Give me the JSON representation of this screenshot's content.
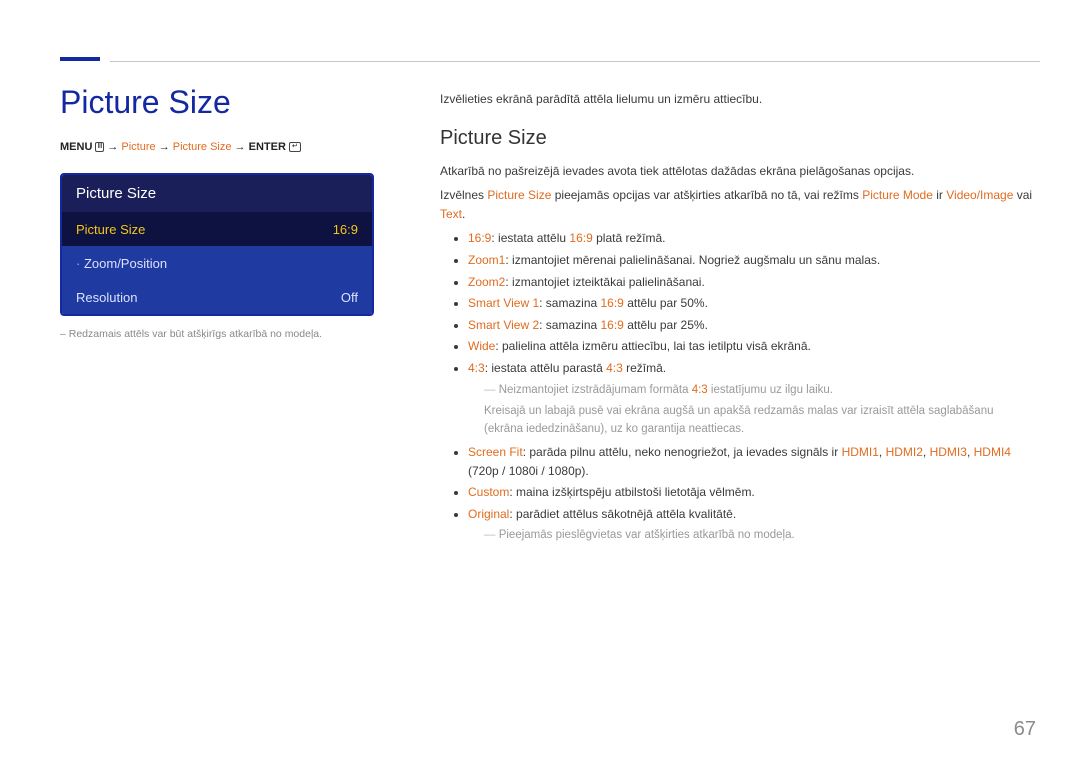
{
  "title": "Picture Size",
  "breadcrumb": {
    "menu": "MENU",
    "picture": "Picture",
    "picture_size": "Picture Size",
    "enter": "ENTER"
  },
  "panel": {
    "header": "Picture Size",
    "rows": [
      {
        "label": "Picture Size",
        "value": "16:9",
        "selected": true
      },
      {
        "label": "Zoom/Position",
        "value": "",
        "prefix": "·",
        "mutedPrefix": true
      },
      {
        "label": "Resolution",
        "value": "Off"
      }
    ]
  },
  "caption": "–  Redzamais attēls var būt atšķirīgs atkarībā no modeļa.",
  "intro": "Izvēlieties ekrānā parādītā attēla lielumu un izmēru attiecību.",
  "section_title": "Picture Size",
  "para1": "Atkarībā no pašreizējā ievades avota tiek attēlotas dažādas ekrāna pielāgošanas opcijas.",
  "para2_parts": {
    "a": "Izvēlnes ",
    "b": "Picture Size",
    "c": " pieejamās opcijas var atšķirties atkarībā no tā, vai režīms ",
    "d": "Picture Mode",
    "e": " ir ",
    "f": "Video/Image",
    "g": " vai ",
    "h": "Text",
    "i": "."
  },
  "bullets": [
    {
      "k": "16:9",
      "t": ": iestata attēlu ",
      "k2": "16:9",
      "t2": " platā režīmā."
    },
    {
      "k": "Zoom1",
      "t": ": izmantojiet mērenai palielināšanai. Nogriež augšmalu un sānu malas."
    },
    {
      "k": "Zoom2",
      "t": ": izmantojiet izteiktākai palielināšanai."
    },
    {
      "k": "Smart View 1",
      "t": ": samazina ",
      "k2": "16:9",
      "t2": " attēlu par 50%."
    },
    {
      "k": "Smart View 2",
      "t": ": samazina ",
      "k2": "16:9",
      "t2": " attēlu par 25%."
    },
    {
      "k": "Wide",
      "t": ": palielina attēla izmēru attiecību, lai tas ietilptu visā ekrānā."
    },
    {
      "k": "4:3",
      "t": ": iestata attēlu parastā ",
      "k2": "4:3",
      "t2": " režīmā."
    }
  ],
  "note43_a": "Neizmantojiet izstrādājumam formāta ",
  "note43_k": "4:3",
  "note43_b": " iestatījumu uz ilgu laiku.",
  "note43_c": "Kreisajā un labajā pusē vai ekrāna augšā un apakšā redzamās malas var izraisīt attēla saglabāšanu (ekrāna iededzināšanu), uz ko garantija neattiecas.",
  "screenfit": {
    "k": "Screen Fit",
    "t1": ": parāda pilnu attēlu, neko nenogriežot, ja ievades signāls ir ",
    "h1": "HDMI1",
    "h2": "HDMI2",
    "h3": "HDMI3",
    "h4": "HDMI4",
    "t2": " (720p / 1080i / 1080p)."
  },
  "custom": {
    "k": "Custom",
    "t": ": maina izšķirtspēju atbilstoši lietotāja vēlmēm."
  },
  "original": {
    "k": "Original",
    "t": ": parādiet attēlus sākotnējā attēla kvalitātē."
  },
  "note_ports": "Pieejamās pieslēgvietas var atšķirties atkarībā no modeļa.",
  "page_number": "67"
}
